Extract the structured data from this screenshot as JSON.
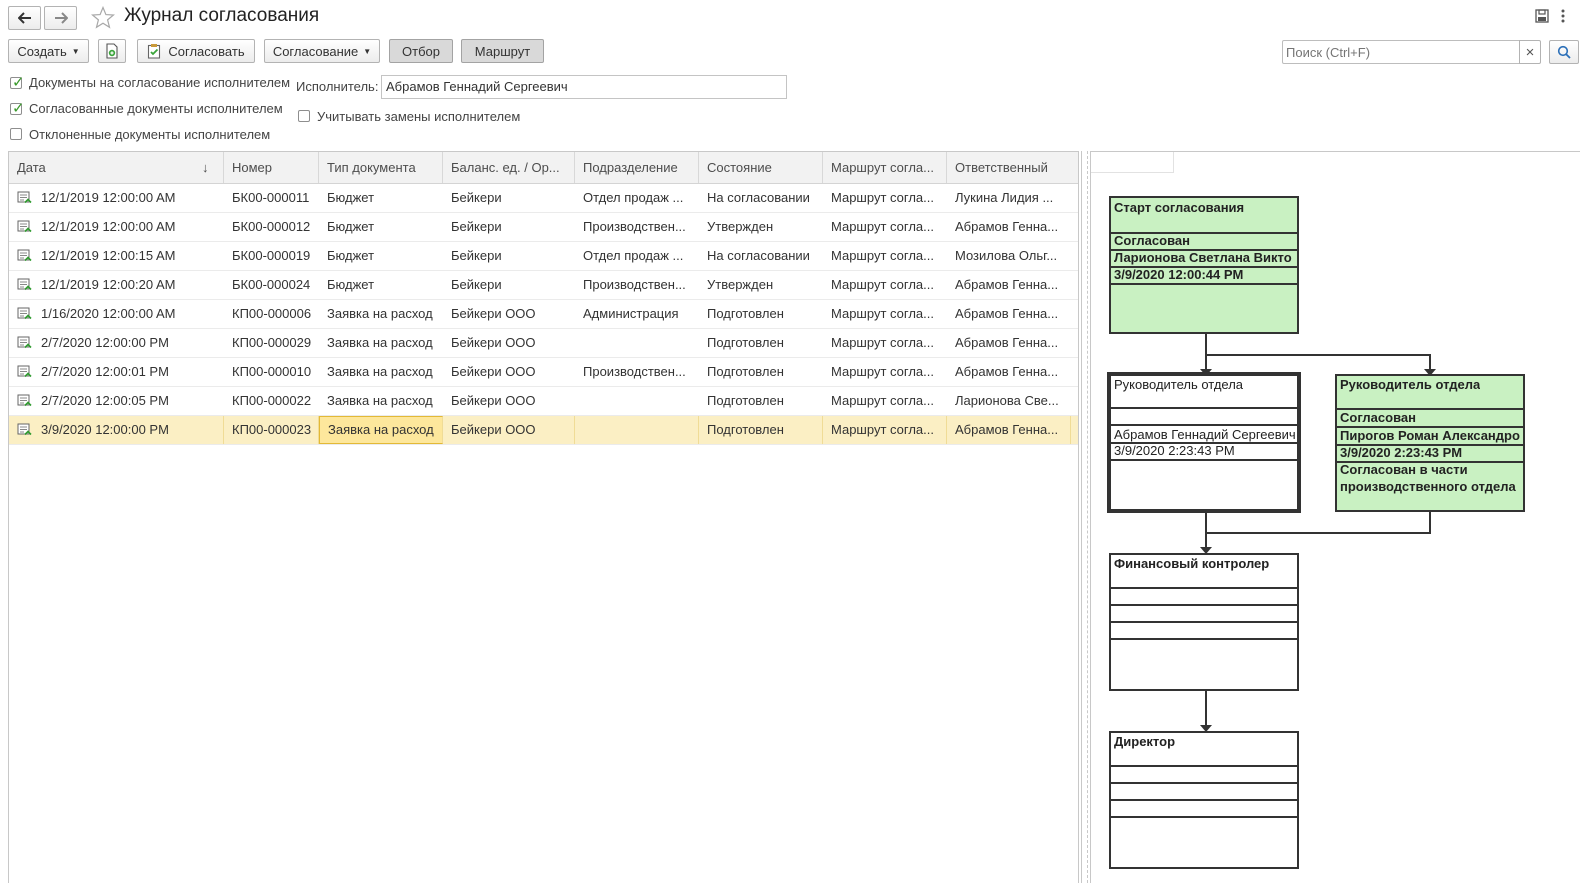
{
  "window": {
    "title": "Журнал согласования"
  },
  "toolbar": {
    "create_label": "Создать",
    "approve_label": "Согласовать",
    "approval_menu_label": "Согласование",
    "filter_label": "Отбор",
    "route_label": "Маршрут",
    "search_placeholder": "Поиск (Ctrl+F)",
    "search_clear": "×"
  },
  "filters": {
    "on_approval": {
      "label": "Документы на согласование исполнителем",
      "checked": true
    },
    "approved": {
      "label": "Согласованные документы исполнителем",
      "checked": true
    },
    "rejected": {
      "label": "Отклоненные документы исполнителем",
      "checked": false
    },
    "executor_label": "Исполнитель:",
    "executor_value": "Абрамов Геннадий Сергеевич",
    "consider_replacements": {
      "label": "Учитывать замены исполнителем",
      "checked": false
    }
  },
  "table": {
    "columns": [
      "Дата",
      "Номер",
      "Тип документа",
      "Баланс. ед. / Ор...",
      "Подразделение",
      "Состояние",
      "Маршрут согла...",
      "Ответственный"
    ],
    "sort_indicator": "↓",
    "rows": [
      {
        "date": "12/1/2019 12:00:00 AM",
        "number": "БК00-000011",
        "type": "Бюджет",
        "org": "Бейкери",
        "dept": "Отдел продаж ...",
        "state": "На согласовании",
        "route": "Маршрут согла...",
        "resp": "Лукина Лидия ..."
      },
      {
        "date": "12/1/2019 12:00:00 AM",
        "number": "БК00-000012",
        "type": "Бюджет",
        "org": "Бейкери",
        "dept": "Производствен...",
        "state": "Утвержден",
        "route": "Маршрут согла...",
        "resp": "Абрамов Генна..."
      },
      {
        "date": "12/1/2019 12:00:15 AM",
        "number": "БК00-000019",
        "type": "Бюджет",
        "org": "Бейкери",
        "dept": "Отдел продаж ...",
        "state": "На согласовании",
        "route": "Маршрут согла...",
        "resp": "Мозилова Ольг..."
      },
      {
        "date": "12/1/2019 12:00:20 AM",
        "number": "БК00-000024",
        "type": "Бюджет",
        "org": "Бейкери",
        "dept": "Производствен...",
        "state": "Утвержден",
        "route": "Маршрут согла...",
        "resp": "Абрамов Генна..."
      },
      {
        "date": "1/16/2020 12:00:00 AM",
        "number": "КП00-000006",
        "type": "Заявка на расход",
        "org": "Бейкери ООО",
        "dept": "Администрация",
        "state": "Подготовлен",
        "route": "Маршрут согла...",
        "resp": "Абрамов Генна..."
      },
      {
        "date": "2/7/2020 12:00:00 PM",
        "number": "КП00-000029",
        "type": "Заявка на расход",
        "org": "Бейкери ООО",
        "dept": "",
        "state": "Подготовлен",
        "route": "Маршрут согла...",
        "resp": "Абрамов Генна..."
      },
      {
        "date": "2/7/2020 12:00:01 PM",
        "number": "КП00-000010",
        "type": "Заявка на расход",
        "org": "Бейкери ООО",
        "dept": "Производствен...",
        "state": "Подготовлен",
        "route": "Маршрут согла...",
        "resp": "Абрамов Генна..."
      },
      {
        "date": "2/7/2020 12:00:05 PM",
        "number": "КП00-000022",
        "type": "Заявка на расход",
        "org": "Бейкери ООО",
        "dept": "",
        "state": "Подготовлен",
        "route": "Маршрут согла...",
        "resp": "Ларионова Све..."
      },
      {
        "date": "3/9/2020 12:00:00 PM",
        "number": "КП00-000023",
        "type": "Заявка на расход",
        "org": "Бейкери ООО",
        "dept": "",
        "state": "Подготовлен",
        "route": "Маршрут согла...",
        "resp": "Абрамов Генна..."
      }
    ],
    "selected_row": 8
  },
  "diagram": {
    "start": {
      "title": "Старт согласования",
      "status": "Согласован",
      "person": "Ларионова Светлана Викто",
      "datetime": "3/9/2020 12:00:44 PM"
    },
    "head_left": {
      "title": "Руководитель отдела",
      "person": "Абрамов Геннадий Сергеевич",
      "datetime": "3/9/2020 2:23:43 PM"
    },
    "head_right": {
      "title": "Руководитель отдела",
      "status": "Согласован",
      "person": "Пирогов Роман Александро",
      "datetime": "3/9/2020 2:23:43 PM",
      "comment_line1": "Согласован в части",
      "comment_line2": "производственного отдела"
    },
    "fin": {
      "title": "Финансовый контролер"
    },
    "director": {
      "title": "Директор"
    }
  },
  "colors": {
    "approved_fill": "#c9f1c2",
    "selected_row": "#fbefc4",
    "focused_cell": "#fde79c"
  }
}
